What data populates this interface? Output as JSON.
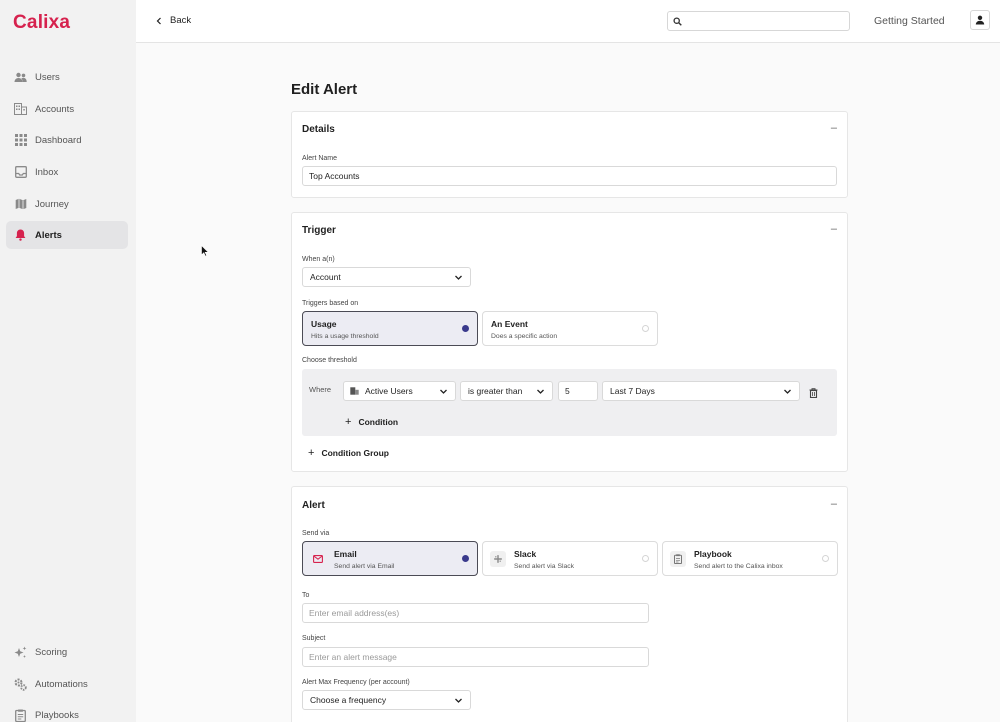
{
  "app": {
    "logo": "Calixa"
  },
  "sidebar": {
    "items": [
      {
        "label": "Users",
        "icon": "users-icon"
      },
      {
        "label": "Accounts",
        "icon": "building-icon"
      },
      {
        "label": "Dashboard",
        "icon": "grid-icon"
      },
      {
        "label": "Inbox",
        "icon": "inbox-icon"
      },
      {
        "label": "Journey",
        "icon": "map-icon"
      },
      {
        "label": "Alerts",
        "icon": "bell-icon",
        "active": true
      }
    ],
    "bottom_items": [
      {
        "label": "Scoring",
        "icon": "sparkle-icon"
      },
      {
        "label": "Automations",
        "icon": "cogs-icon"
      },
      {
        "label": "Playbooks",
        "icon": "clipboard-icon"
      }
    ]
  },
  "topbar": {
    "back_label": "Back",
    "search_placeholder": "",
    "getting_started": "Getting Started"
  },
  "page": {
    "title": "Edit Alert"
  },
  "details": {
    "title": "Details",
    "collapse": "–",
    "alert_name_label": "Alert Name",
    "alert_name_value": "Top Accounts"
  },
  "trigger": {
    "title": "Trigger",
    "collapse": "–",
    "when_label": "When a(n)",
    "when_value": "Account",
    "based_on_label": "Triggers based on",
    "options": [
      {
        "title": "Usage",
        "subtitle": "Hits a usage threshold",
        "selected": true
      },
      {
        "title": "An Event",
        "subtitle": "Does a specific action",
        "selected": false
      }
    ],
    "threshold_label": "Choose threshold",
    "where_label": "Where",
    "metric_value": "Active Users",
    "operator_value": "is greater than",
    "number_value": "5",
    "period_value": "Last 7 Days",
    "add_condition": "Condition",
    "add_condition_group": "Condition Group"
  },
  "alert": {
    "title": "Alert",
    "collapse": "–",
    "send_via_label": "Send via",
    "channels": [
      {
        "title": "Email",
        "subtitle": "Send alert via Email",
        "icon": "mail-icon",
        "selected": true
      },
      {
        "title": "Slack",
        "subtitle": "Send alert via Slack",
        "icon": "slack-icon",
        "selected": false
      },
      {
        "title": "Playbook",
        "subtitle": "Send alert to the Calixa inbox",
        "icon": "clipboard-icon",
        "selected": false
      }
    ],
    "to_label": "To",
    "to_placeholder": "Enter email address(es)",
    "subject_label": "Subject",
    "subject_placeholder": "Enter an alert message",
    "frequency_label": "Alert Max Frequency (per account)",
    "frequency_value": "Choose a frequency"
  },
  "colors": {
    "brand": "#d6224e",
    "selected_radio": "#3a3a8c",
    "sidebar_bg": "#f2f2f2"
  }
}
